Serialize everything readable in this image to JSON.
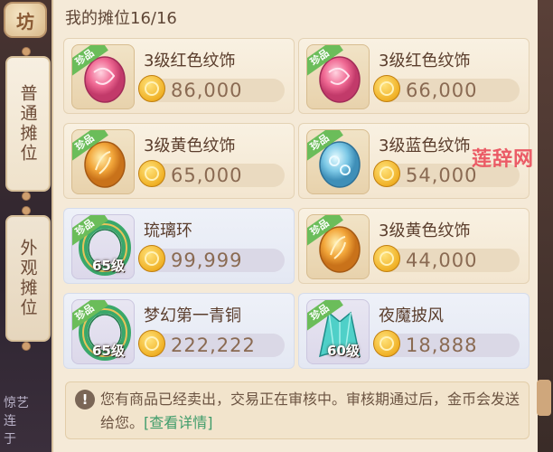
{
  "header": {
    "title": "我的摊位16/16"
  },
  "sidebar": {
    "badge": "坊",
    "tabs": [
      {
        "label": "普通摊位",
        "active": true
      },
      {
        "label": "外观摊位",
        "active": false
      }
    ],
    "side_text": "惊艺\n连\n于"
  },
  "colors": {
    "accent_green": "#6bbd5a",
    "coin_gold": "#f0b126",
    "link_green": "#3f9c6a",
    "watermark_red": "#ea4c5a"
  },
  "items": [
    {
      "name": "3级红色纹饰",
      "price": "86,000",
      "rare_tag": "珍品",
      "level": "",
      "icon": "red-ornament-icon",
      "style": "warm"
    },
    {
      "name": "3级红色纹饰",
      "price": "66,000",
      "rare_tag": "珍品",
      "level": "",
      "icon": "red-ornament-icon",
      "style": "warm"
    },
    {
      "name": "3级黄色纹饰",
      "price": "65,000",
      "rare_tag": "珍品",
      "level": "",
      "icon": "yellow-ornament-icon",
      "style": "warm"
    },
    {
      "name": "3级蓝色纹饰",
      "price": "54,000",
      "rare_tag": "珍品",
      "level": "",
      "icon": "blue-ornament-icon",
      "style": "warm"
    },
    {
      "name": "琉璃环",
      "price": "99,999",
      "rare_tag": "珍品",
      "level": "65级",
      "icon": "jade-ring-icon",
      "style": "blue"
    },
    {
      "name": "3级黄色纹饰",
      "price": "44,000",
      "rare_tag": "珍品",
      "level": "",
      "icon": "yellow-ornament-icon",
      "style": "warm"
    },
    {
      "name": "梦幻第一青铜",
      "price": "222,222",
      "rare_tag": "珍品",
      "level": "65级",
      "icon": "jade-ring-icon",
      "style": "blue"
    },
    {
      "name": "夜魔披风",
      "price": "18,888",
      "rare_tag": "珍品",
      "level": "60级",
      "icon": "cloak-icon",
      "style": "blue"
    }
  ],
  "notice": {
    "icon": "!",
    "text": "您有商品已经卖出，交易正在审核中。审核期通过后，金币会发送给您。",
    "link": "[查看详情]"
  },
  "watermark": "莲辞网"
}
